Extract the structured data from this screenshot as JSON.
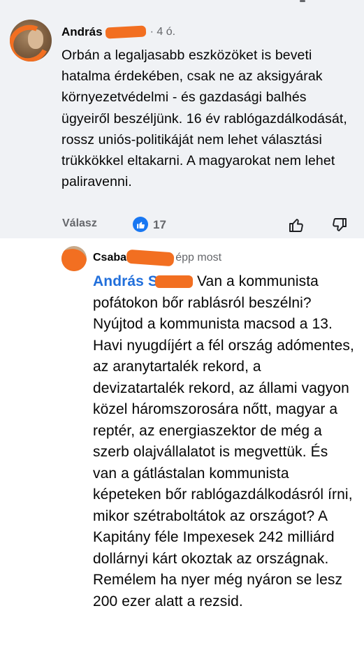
{
  "comment": {
    "author": "András S",
    "meta": "· 4 ó.",
    "text": "Orbán a legaljasabb eszközöket is beveti hatalma érdekében, csak ne az aksigyárak környezetvédelmi - és gazdasági balhés ügyeiről beszéljünk. 16 év rablógazdálkodását, rossz uniós-politikáját nem lehet választási trükkökkel eltakarni. A magyarokat nem lehet paliravenni.",
    "reply_label": "Válasz",
    "like_count": "17",
    "icons": {
      "like": "thumbs-up-icon",
      "dislike": "thumbs-down-icon",
      "reaction": "like-reaction-icon"
    },
    "colors": {
      "accent": "#1877f2",
      "bg": "#f0f2f5"
    }
  },
  "reply": {
    "author": "Csaba F",
    "time": "épp most",
    "mention": "András S",
    "text": "Van a kommunista pofátokon bőr rablásról beszélni? Nyújtod a kommunista macsod a 13. Havi nyugdíjért a fél ország adómentes, az aranytartalék rekord, a devizatartalék rekord, az állami vagyon közel háromszorosára nőtt, magyar a reptér, az energiaszektor de még a szerb olajvállalatot is megvettük. És van a gátlástalan kommunista képeteken bőr rablógazdálkodásról írni, mikor szétraboltátok az országot? A Kapitány féle Impexesek 242 milliárd dollárnyi kárt okoztak az országnak. Remélem ha nyer még nyáron se lesz 200 ezer alatt a rezsid."
  }
}
